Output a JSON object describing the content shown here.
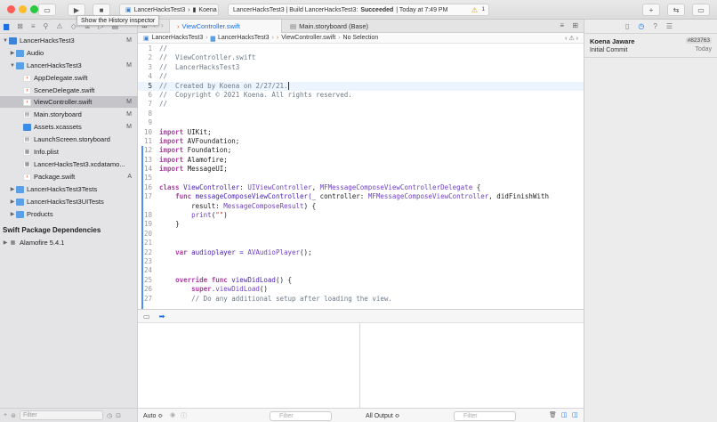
{
  "toolbar": {
    "scheme": "LancerHacksTest3",
    "device": "Koena",
    "activity_prefix": "LancerHacksTest3 | Build LancerHacksTest3: ",
    "activity_status": "Succeeded",
    "activity_time": " | Today at 7:49 PM",
    "warnings": "1",
    "tooltip": "Show the History inspector"
  },
  "navigator": {
    "items": [
      {
        "label": "LancerHacksTest3",
        "badge": "M"
      },
      {
        "label": "Audio",
        "badge": ""
      },
      {
        "label": "LancerHacksTest3",
        "badge": "M"
      },
      {
        "label": "AppDelegate.swift",
        "badge": ""
      },
      {
        "label": "SceneDelegate.swift",
        "badge": ""
      },
      {
        "label": "ViewController.swift",
        "badge": "M"
      },
      {
        "label": "Main.storyboard",
        "badge": "M"
      },
      {
        "label": "Assets.xcassets",
        "badge": "M"
      },
      {
        "label": "LaunchScreen.storyboard",
        "badge": ""
      },
      {
        "label": "Info.plist",
        "badge": ""
      },
      {
        "label": "LancerHacksTest3.xcdatamo...",
        "badge": ""
      },
      {
        "label": "Package.swift",
        "badge": "A"
      },
      {
        "label": "LancerHacksTest3Tests",
        "badge": ""
      },
      {
        "label": "LancerHacksTest3UITests",
        "badge": ""
      },
      {
        "label": "Products",
        "badge": ""
      }
    ],
    "section_title": "Swift Package Dependencies",
    "package_name": "Alamofire",
    "package_version": "5.4.1",
    "filter_placeholder": "Filter"
  },
  "editor": {
    "tabs": {
      "active": "ViewController.swift",
      "inactive": "Main.storyboard (Base)"
    },
    "breadcrumb": [
      "LancerHacksTest3",
      "LancerHacksTest3",
      "ViewController.swift",
      "No Selection"
    ],
    "line_numbers": [
      "1",
      "2",
      "3",
      "4",
      "5",
      "6",
      "7",
      "8",
      "9",
      "10",
      "11",
      "12",
      "13",
      "14",
      "15",
      "16",
      "17",
      "",
      "18",
      "19",
      "20",
      "21",
      "22",
      "23",
      "24",
      "25",
      "26",
      "27"
    ],
    "lines": {
      "l1": "//",
      "l2": "//  ViewController.swift",
      "l3": "//  LancerHacksTest3",
      "l4": "//",
      "l5": "//  Created by Koena on 2/27/21.",
      "l6": "//  Copyright © 2021 Koena. All rights reserved.",
      "l7": "//",
      "k_import": "import",
      "m_uikit": " UIKit;",
      "m_avf": " AVFoundation;",
      "m_found": " Foundation;",
      "m_alamo": " Alamofire;",
      "m_msg": " MessageUI;",
      "k_class": "class",
      "cls_name": " ViewController: ",
      "t_uivc": "UIViewController",
      "comma": ", ",
      "t_mfdel": "MFMessageComposeViewControllerDelegate",
      "brace_open": " {",
      "k_func": "func",
      "fn_compose": " messageComposeViewController(",
      "p_controller": "_ controller: ",
      "t_mfvc": "MFMessageComposeViewController",
      "p_didfinish": ", didFinishWith",
      "p_result": "result: ",
      "t_result": "MessageComposeResult",
      "paren_brace": ") {",
      "f_print": "print",
      "s_empty": "\"\"",
      "p_open": "(",
      "p_close": ")",
      "brace_close": "}",
      "k_var": "var",
      "v_player": " audioplayer = ",
      "t_avp": "AVAudioPlayer",
      "call_end": "();",
      "k_override": "override",
      "fn_vdl": " viewDidLoad",
      "k_super": "super",
      "super_vdl": ".viewDidLoad",
      "call_pair": "()",
      "c_setup": "// Do any additional setup after loading the view."
    }
  },
  "debug": {
    "scope": "Auto ≎",
    "filter_left": "Filter",
    "output": "All Output ≎",
    "filter_right": "Filter"
  },
  "inspector": {
    "author": "Koena Jaware",
    "hash": "#823763",
    "message": "Initial Commit",
    "date": "Today"
  }
}
